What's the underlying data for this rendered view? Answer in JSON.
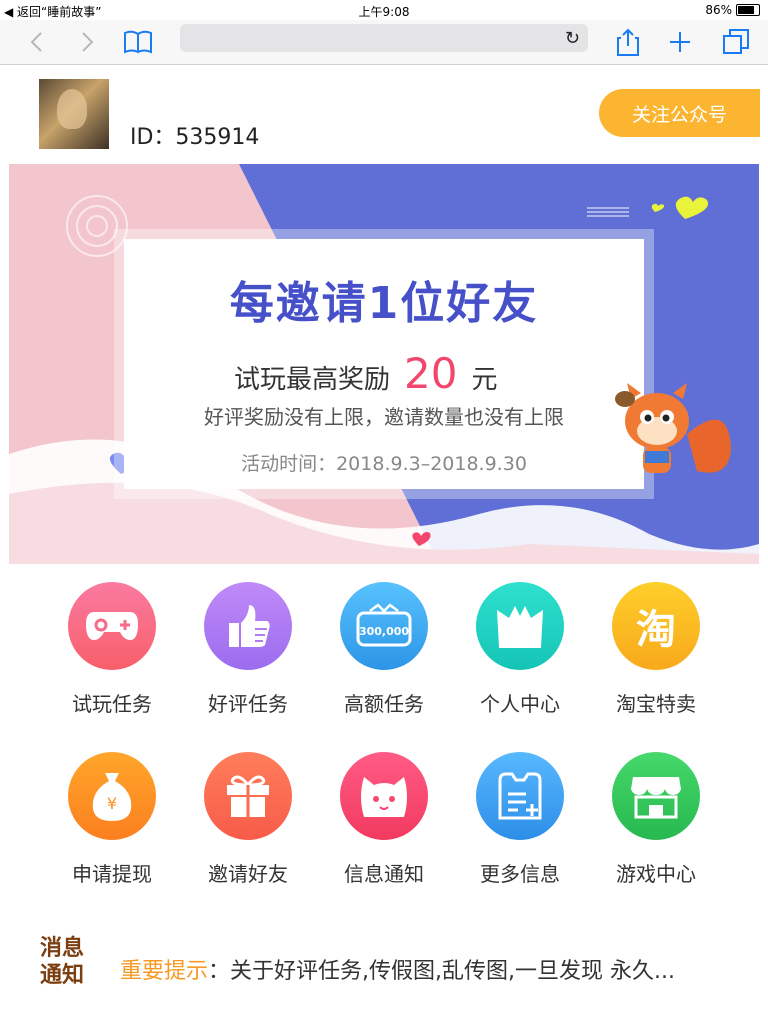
{
  "status_bar": {
    "back_app": "返回“睡前故事”",
    "time": "上午9:08",
    "battery": "86%"
  },
  "toolbar": {
    "back_icon": "chevron-left-icon",
    "forward_icon": "chevron-right-icon",
    "bookmarks_icon": "book-icon",
    "reload_icon": "reload-icon",
    "share_icon": "share-icon",
    "add_icon": "plus-icon",
    "tabs_icon": "tabs-icon"
  },
  "header": {
    "user_id": "ID：535914",
    "follow_button": "关注公众号"
  },
  "banner": {
    "headline": "每邀请1位好友",
    "reward_prefix": "试玩最高奖励",
    "reward_amount": "20",
    "reward_unit": "元",
    "description": "好评奖励没有上限，邀请数量也没有上限",
    "activity_time": "活动时间：2018.9.3–2018.9.30"
  },
  "menu": {
    "items": [
      {
        "label": "试玩任务",
        "icon": "gamepad-icon",
        "color": "#f76a8a"
      },
      {
        "label": "好评任务",
        "icon": "thumbs-up-icon",
        "color": "#b07cf2"
      },
      {
        "label": "高额任务",
        "icon": "cash-icon",
        "color": "#3eaaf0",
        "badge": "300,000"
      },
      {
        "label": "个人中心",
        "icon": "cat-icon",
        "color": "#21d3c3"
      },
      {
        "label": "淘宝特卖",
        "icon": "taobao-icon",
        "color": "#fcc21b",
        "glyph": "淘"
      },
      {
        "label": "申请提现",
        "icon": "money-bag-icon",
        "color": "#fd8f22",
        "glyph": "¥"
      },
      {
        "label": "邀请好友",
        "icon": "gift-icon",
        "color": "#fb6a53"
      },
      {
        "label": "信息通知",
        "icon": "mascot-face-icon",
        "color": "#f7476f"
      },
      {
        "label": "更多信息",
        "icon": "note-icon",
        "color": "#3ea5f4"
      },
      {
        "label": "游戏中心",
        "icon": "store-icon",
        "color": "#34c759"
      }
    ]
  },
  "notice": {
    "logo_line1": "消息",
    "logo_line2": "通知",
    "tag": "重要提示",
    "text": "：关于好评任务,传假图,乱传图,一旦发现 永久..."
  }
}
